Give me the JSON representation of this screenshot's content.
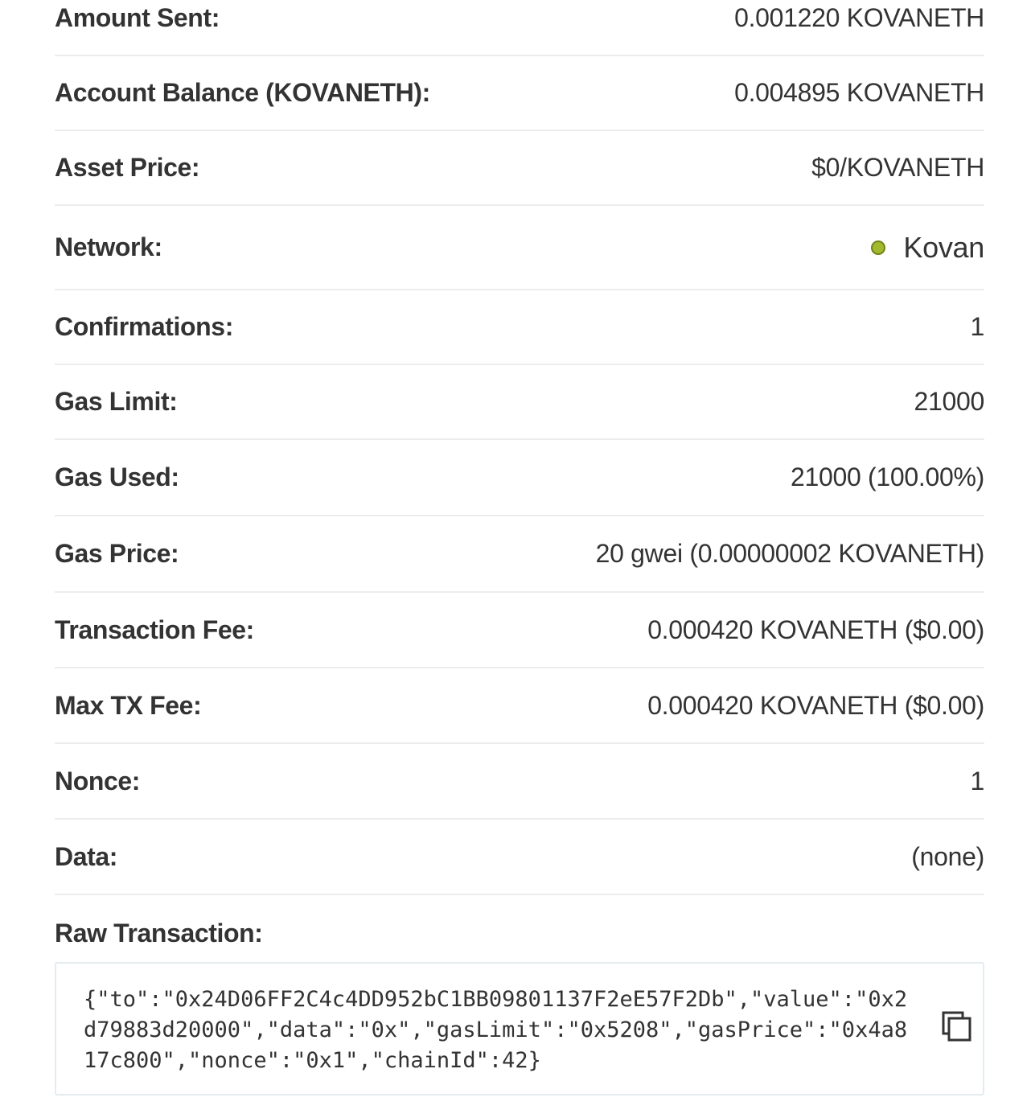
{
  "rows": [
    {
      "label": "Amount Sent:",
      "value": "0.001220 KOVANETH"
    },
    {
      "label": "Account Balance (KOVANETH):",
      "value": "0.004895 KOVANETH"
    },
    {
      "label": "Asset Price:",
      "value": "$0/KOVANETH"
    },
    {
      "label": "Network:",
      "value": "Kovan",
      "status_color": "#a3b82c"
    },
    {
      "label": "Confirmations:",
      "value": "1"
    },
    {
      "label": "Gas Limit:",
      "value": "21000"
    },
    {
      "label": "Gas Used:",
      "value": "21000 (100.00%)"
    },
    {
      "label": "Gas Price:",
      "value": "20 gwei (0.00000002 KOVANETH)"
    },
    {
      "label": "Transaction Fee:",
      "value": "0.000420 KOVANETH ($0.00)"
    },
    {
      "label": "Max TX Fee:",
      "value": "0.000420 KOVANETH ($0.00)"
    },
    {
      "label": "Nonce:",
      "value": "1"
    },
    {
      "label": "Data:",
      "value": "(none)"
    }
  ],
  "raw_transaction": {
    "label": "Raw Transaction:",
    "text": "{\"to\":\"0x24D06FF2C4c4DD952bC1BB09801137F2eE57F2Db\",\"value\":\"0x2d79883d20000\",\"data\":\"0x\",\"gasLimit\":\"0x5208\",\"gasPrice\":\"0x4a817c800\",\"nonce\":\"0x1\",\"chainId\":42}",
    "copy_icon": "copy-icon"
  }
}
